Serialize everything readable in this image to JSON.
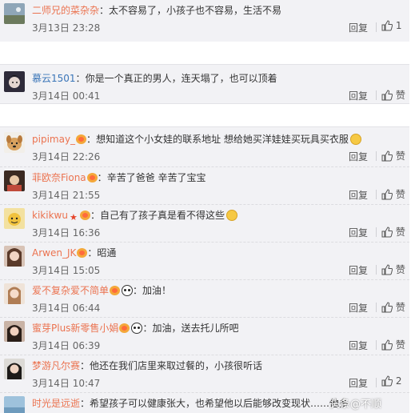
{
  "actions": {
    "reply": "回复",
    "like": "赞"
  },
  "comments": [
    {
      "user": "二师兄的菜杂杂",
      "colon": "：",
      "text": "太不容易了，小孩子也不容易，生活不易",
      "time": "3月13日 23:28",
      "like_count": "1",
      "badges": []
    },
    {
      "user": "慕云1501",
      "colon": "：",
      "text": "你是一个真正的男人，连天塌了，也可以顶着",
      "time": "3月14日 00:41",
      "like_count": "",
      "badges": []
    },
    {
      "user": "pipimay_",
      "colon": "：",
      "text": "想知道这个小女娃的联系地址 想给她买洋娃娃买玩具买衣服",
      "time": "3月14日 22:26",
      "like_count": "",
      "badges": [
        "vip-badge-icon"
      ],
      "emoji": [
        "smile-emoji-icon"
      ]
    },
    {
      "user": "菲欧奈Fiona",
      "colon": "：",
      "text": "辛苦了爸爸 辛苦了宝宝",
      "time": "3月14日 21:55",
      "like_count": "",
      "badges": [
        "vip-badge-icon"
      ]
    },
    {
      "user": "kikikwu",
      "colon": "：",
      "text": "自己有了孩子真是看不得这些",
      "time": "3月14日 16:36",
      "like_count": "",
      "badges": [
        "star-badge-icon",
        "vip-badge-icon"
      ],
      "emoji": [
        "cry-emoji-icon"
      ]
    },
    {
      "user": "Arwen_JK",
      "colon": "：",
      "text": "昭通",
      "time": "3月14日 15:05",
      "like_count": "",
      "badges": [
        "vip-badge-icon"
      ]
    },
    {
      "user": "爱不复杂爱不简单",
      "colon": "：",
      "text": "加油！",
      "time": "3月14日 06:44",
      "like_count": "",
      "badges": [
        "vip-badge-icon",
        "panda-badge-icon"
      ]
    },
    {
      "user": "蜜芽Plus新零售小娟",
      "colon": "：",
      "text": "加油，送去托儿所吧",
      "time": "3月14日 06:39",
      "like_count": "",
      "badges": [
        "vip-badge-icon",
        "panda-badge-icon"
      ]
    },
    {
      "user": "梦游凡尔赛",
      "colon": "：",
      "text": "他还在我们店里来取过餐的，小孩很听话",
      "time": "3月14日 10:47",
      "like_count": "2",
      "badges": []
    },
    {
      "user": "时光是远逝",
      "colon": "：",
      "text": "希望孩子可以健康张大，也希望他以后能够改变现状……他多",
      "time": "",
      "like_count": "",
      "badges": []
    }
  ],
  "watermark": "头条@不顺",
  "colors": {
    "username_orange": "#eb7350",
    "username_blue": "#3a75b8",
    "panel_bg": "#f2f2f5"
  }
}
